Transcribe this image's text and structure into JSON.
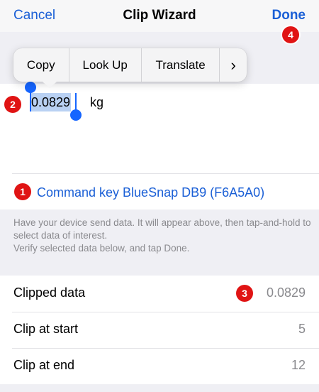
{
  "nav": {
    "cancel": "Cancel",
    "title": "Clip Wizard",
    "done": "Done"
  },
  "menu": {
    "items": [
      "Copy",
      "Look Up",
      "Translate"
    ],
    "more": "›"
  },
  "input": {
    "value": "0.0829",
    "unit": "kg"
  },
  "command": {
    "label": "Command key BlueSnap DB9 (F6A5A0)"
  },
  "help": {
    "line1": "Have your device send data. It will appear above, then tap-and-hold to select data of interest.",
    "line2": "Verify selected data below, and tap Done."
  },
  "rows": [
    {
      "label": "Clipped data",
      "value": "0.0829"
    },
    {
      "label": "Clip at start",
      "value": "5"
    },
    {
      "label": "Clip at end",
      "value": "12"
    }
  ],
  "badges": [
    "1",
    "2",
    "3",
    "4"
  ],
  "colors": {
    "accent": "#1a5fd6",
    "badge": "#e01414",
    "selection": "#b9d1f3",
    "handle": "#1565ff"
  }
}
